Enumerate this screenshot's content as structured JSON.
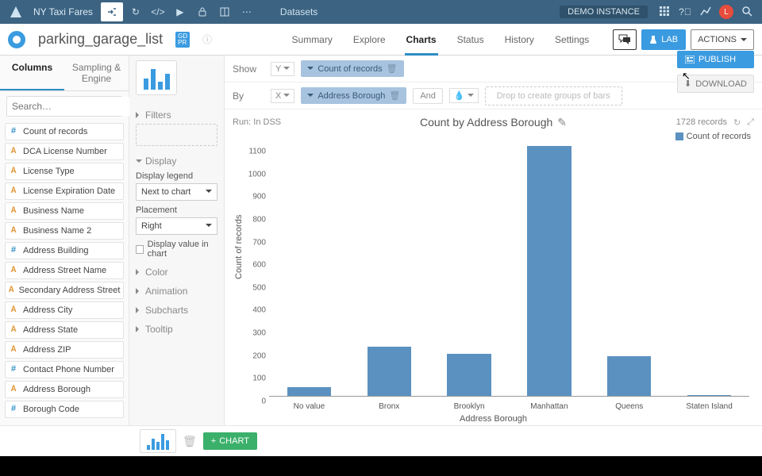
{
  "topbar": {
    "project_name": "NY Taxi Fares",
    "breadcrumb": "Datasets",
    "demo_label": "DEMO INSTANCE",
    "avatar_initial": "L"
  },
  "secbar": {
    "dataset_name": "parking_garage_list",
    "gdpr_badge": "GD\nPR",
    "tabs": [
      "Summary",
      "Explore",
      "Charts",
      "Status",
      "History",
      "Settings"
    ],
    "active_tab": "Charts",
    "lab_label": "LAB",
    "actions_label": "ACTIONS"
  },
  "left_panel": {
    "tabs": [
      "Columns",
      "Sampling & Engine"
    ],
    "active_tab": "Columns",
    "search_placeholder": "Search…",
    "columns": [
      {
        "type": "num",
        "name": "Count of records"
      },
      {
        "type": "str",
        "name": "DCA License Number"
      },
      {
        "type": "str",
        "name": "License Type"
      },
      {
        "type": "str",
        "name": "License Expiration Date"
      },
      {
        "type": "str",
        "name": "Business Name"
      },
      {
        "type": "str",
        "name": "Business Name 2"
      },
      {
        "type": "num",
        "name": "Address Building"
      },
      {
        "type": "str",
        "name": "Address Street Name"
      },
      {
        "type": "str",
        "name": "Secondary Address Street Name"
      },
      {
        "type": "str",
        "name": "Address City"
      },
      {
        "type": "str",
        "name": "Address State"
      },
      {
        "type": "str",
        "name": "Address ZIP"
      },
      {
        "type": "num",
        "name": "Contact Phone Number"
      },
      {
        "type": "str",
        "name": "Address Borough"
      },
      {
        "type": "num",
        "name": "Borough Code"
      }
    ]
  },
  "mid_panel": {
    "filters_label": "Filters",
    "display_label": "Display",
    "legend_setting_label": "Display legend",
    "legend_setting_value": "Next to chart",
    "placement_label": "Placement",
    "placement_value": "Right",
    "value_in_chart_label": "Display value in chart",
    "color_label": "Color",
    "animation_label": "Animation",
    "subcharts_label": "Subcharts",
    "tooltip_label": "Tooltip"
  },
  "config": {
    "show_label": "Show",
    "y_label": "Y",
    "y_measure": "Count of records",
    "by_label": "By",
    "x_label": "X",
    "x_dimension": "Address Borough",
    "and_label": "And",
    "drop_hint": "Drop to create groups of bars",
    "publish_label": "PUBLISH",
    "download_label": "DOWNLOAD"
  },
  "chart_header": {
    "run_label": "Run: In DSS",
    "title": "Count by Address Borough",
    "records_label": "1728 records",
    "legend_label": "Count of records"
  },
  "chart_data": {
    "type": "bar",
    "title": "Count by Address Borough",
    "xlabel": "Address Borough",
    "ylabel": "Count of records",
    "ylim": [
      0,
      1100
    ],
    "y_ticks": [
      0,
      100,
      200,
      300,
      400,
      500,
      600,
      700,
      800,
      900,
      1000,
      1100
    ],
    "categories": [
      "No value",
      "Bronx",
      "Brooklyn",
      "Manhattan",
      "Queens",
      "Staten Island"
    ],
    "values": [
      40,
      215,
      185,
      1100,
      175,
      5
    ],
    "series": [
      {
        "name": "Count of records",
        "values": [
          40,
          215,
          185,
          1100,
          175,
          5
        ]
      }
    ]
  },
  "bottom": {
    "chart_button": "CHART"
  }
}
